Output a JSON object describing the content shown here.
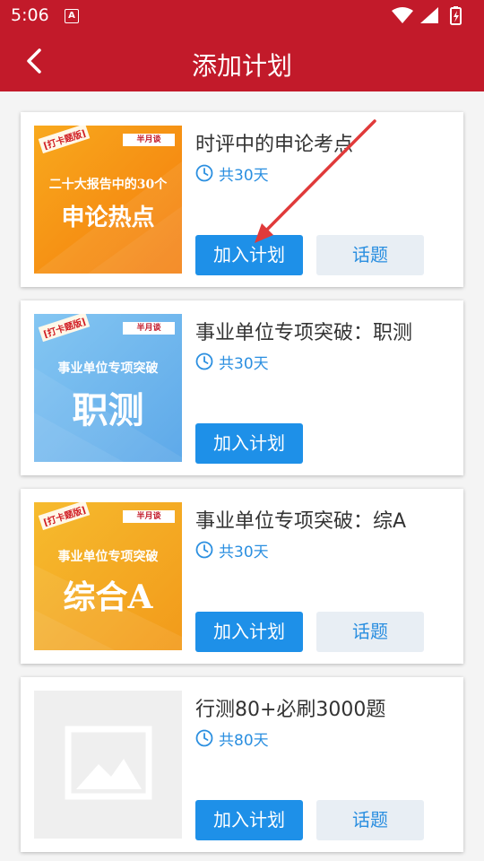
{
  "status_bar": {
    "time": "5:06",
    "notification": "A"
  },
  "app_bar": {
    "title": "添加计划",
    "back_icon": "chevron-left-icon"
  },
  "plans": [
    {
      "title": "时评中的申论考点",
      "duration": "共30天",
      "join_label": "加入计划",
      "topic_label": "话题",
      "has_topic": true,
      "cover": {
        "tag": "[打卡题版]",
        "logo": "半月谈",
        "subtitle": "二十大报告中的30个",
        "main": "申论热点",
        "color_from": "#f7a21a",
        "color_to": "#f57e0e"
      }
    },
    {
      "title": "事业单位专项突破：职测",
      "duration": "共30天",
      "join_label": "加入计划",
      "topic_label": "",
      "has_topic": false,
      "cover": {
        "tag": "[打卡题版]",
        "logo": "半月谈",
        "subtitle": "事业单位专项突破",
        "main": "职测",
        "color_from": "#7cc0f0",
        "color_to": "#5aa7e8"
      }
    },
    {
      "title": "事业单位专项突破：综A",
      "duration": "共30天",
      "join_label": "加入计划",
      "topic_label": "话题",
      "has_topic": true,
      "cover": {
        "tag": "[打卡题版]",
        "logo": "半月谈",
        "subtitle": "事业单位专项突破",
        "main": "综合A",
        "color_from": "#f5b62a",
        "color_to": "#f29b1c"
      }
    },
    {
      "title": "行测80+必刷3000题",
      "duration": "共80天",
      "join_label": "加入计划",
      "topic_label": "话题",
      "has_topic": true,
      "cover": null
    }
  ],
  "colors": {
    "brand": "#c21a2a",
    "accent": "#1e90e8",
    "annotation_arrow": "#e03a3a"
  }
}
